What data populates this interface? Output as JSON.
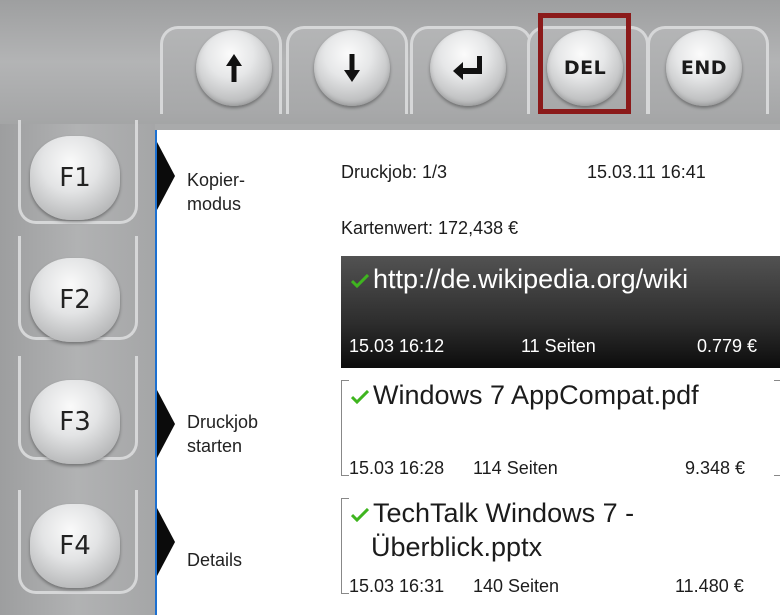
{
  "top_keys": [
    {
      "id": "up",
      "icon": "arrow-up-icon"
    },
    {
      "id": "down",
      "icon": "arrow-down-icon"
    },
    {
      "id": "enter",
      "icon": "enter-icon"
    },
    {
      "id": "del",
      "label": "DEL"
    },
    {
      "id": "end",
      "label": "END"
    }
  ],
  "highlight_color": "#8b1a1a",
  "fkeys": [
    "F1",
    "F2",
    "F3",
    "F4"
  ],
  "softkeys": {
    "f1_line1": "Kopier-",
    "f1_line2": "modus",
    "f3_line1": "Druckjob",
    "f3_line2": "starten",
    "f4": "Details"
  },
  "status": {
    "job_counter": "Druckjob: 1/3",
    "datetime": "15.03.11 16:41",
    "card_value": "Kartenwert: 172,438 €"
  },
  "jobs": [
    {
      "name": "http://de.wikipedia.org/wiki",
      "name2": "",
      "date": "15.03 16:12",
      "pages": "11 Seiten",
      "price": "0.779 €",
      "selected": true
    },
    {
      "name": "Windows 7 AppCompat.pdf",
      "name2": "",
      "date": "15.03 16:28",
      "pages": "114 Seiten",
      "price": "9.348 €",
      "selected": false
    },
    {
      "name": "TechTalk Windows 7 -",
      "name2": "Überblick.pptx",
      "date": "15.03 16:31",
      "pages": "140 Seiten",
      "price": "11.480 €",
      "selected": false
    }
  ],
  "colors": {
    "check": "#3fb51f",
    "screen_border": "#1c6fd0"
  }
}
